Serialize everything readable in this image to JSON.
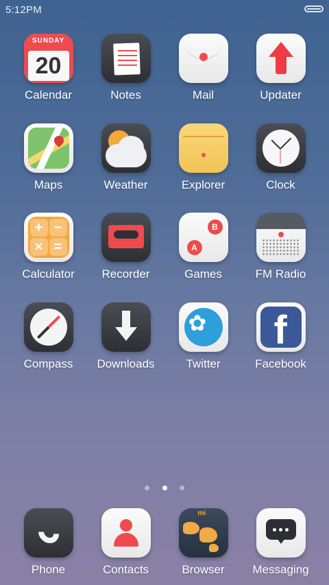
{
  "status": {
    "time": "5:12PM",
    "battery_icon": "battery-icon"
  },
  "apps": [
    {
      "label": "Calendar",
      "weekday": "SUNDAY",
      "day": "20"
    },
    {
      "label": "Notes"
    },
    {
      "label": "Mail"
    },
    {
      "label": "Updater"
    },
    {
      "label": "Maps"
    },
    {
      "label": "Weather"
    },
    {
      "label": "Explorer"
    },
    {
      "label": "Clock"
    },
    {
      "label": "Calculator"
    },
    {
      "label": "Recorder"
    },
    {
      "label": "Games",
      "btn_a": "A",
      "btn_b": "B"
    },
    {
      "label": "FM Radio"
    },
    {
      "label": "Compass"
    },
    {
      "label": "Downloads"
    },
    {
      "label": "Twitter"
    },
    {
      "label": "Facebook",
      "glyph": "f"
    }
  ],
  "dock": [
    {
      "label": "Phone"
    },
    {
      "label": "Contacts"
    },
    {
      "label": "Browser",
      "brand": "mi"
    },
    {
      "label": "Messaging"
    }
  ],
  "pager": {
    "pages": 3,
    "current": 2
  },
  "colors": {
    "accent_red": "#ee4b4f",
    "accent_orange": "#f6a63c",
    "twitter_blue": "#2f9fdc",
    "facebook_blue": "#3b5998"
  }
}
